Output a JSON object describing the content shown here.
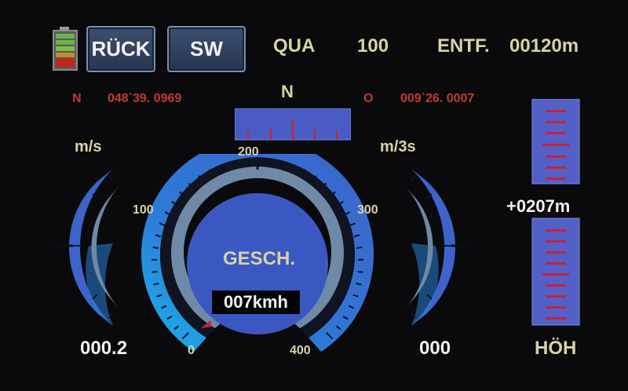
{
  "colors": {
    "background": "#0a0a0c",
    "label": "#d8d3a6",
    "coordinate": "#c23a32",
    "gauge_blue": "#3e63c9",
    "gauge_steel": "#6f8aa6",
    "gauge_cyan": "#1ca8e0",
    "altitude_bar": "#5360c8",
    "altitude_tick": "#c4243a"
  },
  "battery": {
    "icon": "battery-icon",
    "level": 0.8
  },
  "buttons": {
    "back_label": "RÜCK",
    "sw_label": "SW"
  },
  "header": {
    "qua_label": "QUA",
    "qua_value": "100",
    "distance_label": "ENTF.",
    "distance_value": "00120m"
  },
  "gps": {
    "lat_prefix": "N",
    "lat_value": "048`39. 0969",
    "lon_prefix": "O",
    "lon_value": "009`26. 0007"
  },
  "compass": {
    "heading_label": "N"
  },
  "left_gauge": {
    "unit": "m/s",
    "value": "000.2"
  },
  "right_gauge": {
    "unit": "m/3s",
    "value": "000"
  },
  "speed_gauge": {
    "title": "GESCH.",
    "readout": "007kmh",
    "tick_0": "0",
    "tick_100": "100",
    "tick_200": "200",
    "tick_300": "300",
    "tick_400": "400",
    "min": 0,
    "max": 400,
    "current": 7
  },
  "altitude": {
    "value": "+0207m",
    "label": "HÖH"
  }
}
